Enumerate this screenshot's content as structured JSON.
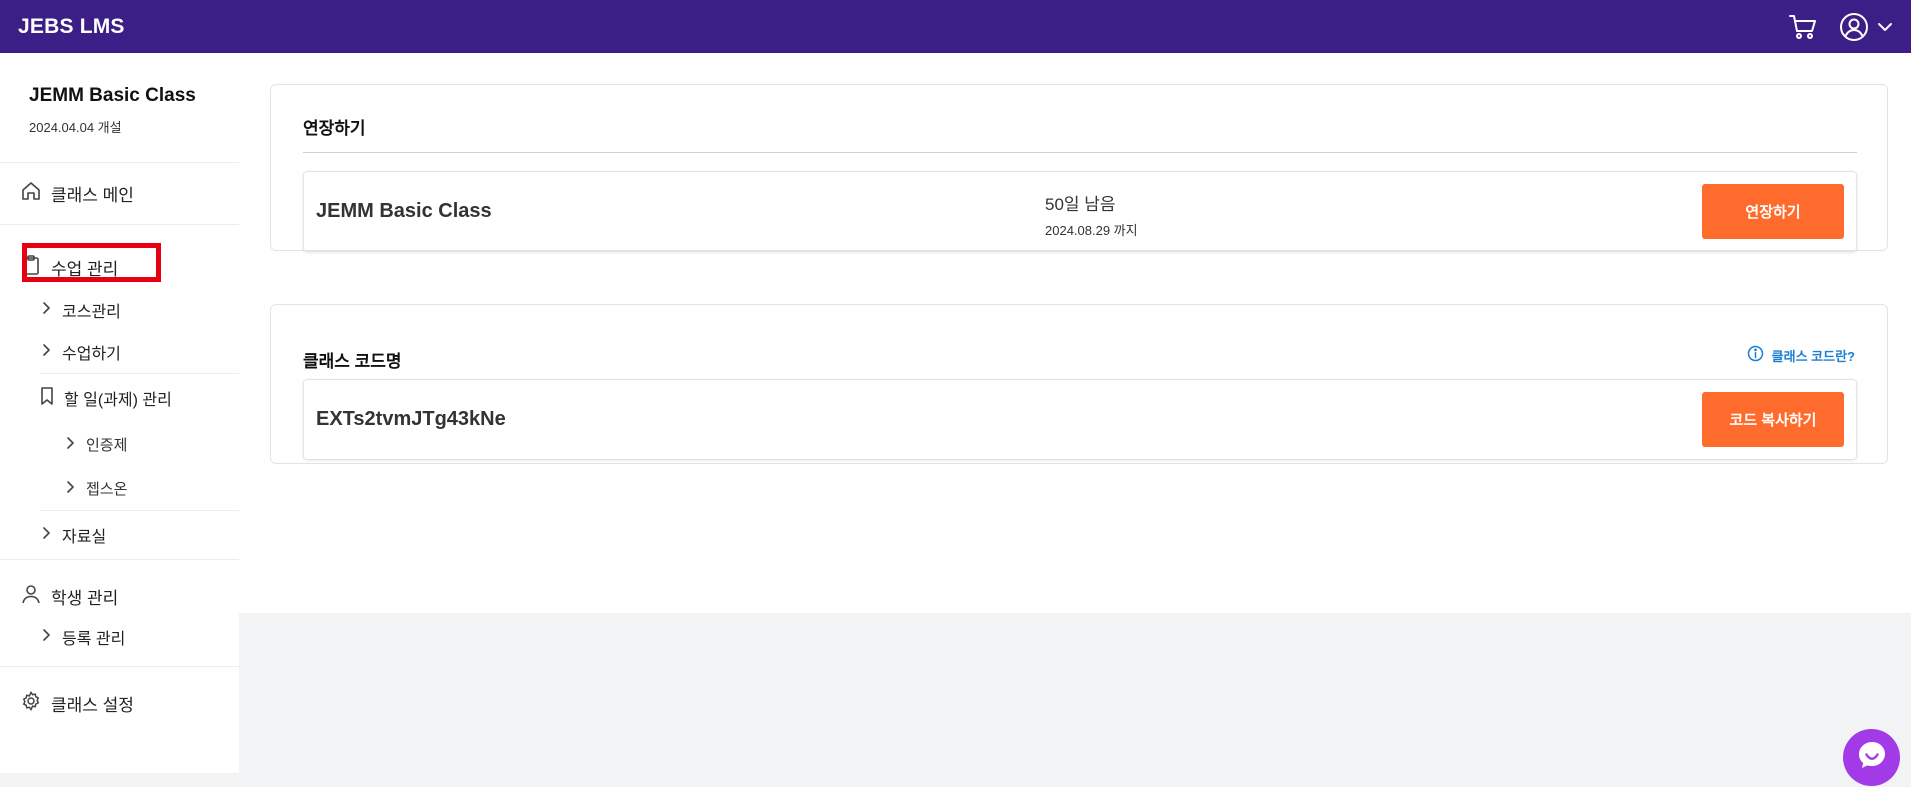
{
  "header": {
    "brand": "JEBS LMS",
    "bg_color": "#3b1f86",
    "icons": [
      "cart-icon",
      "user-circle-icon",
      "chevron-down-icon"
    ]
  },
  "sidebar": {
    "class_title": "JEMM Basic Class",
    "class_date": "2024.04.04 개설",
    "home_label": "클래스 메인",
    "lesson_mgmt_label": "수업 관리",
    "course_mgmt_label": "코스관리",
    "do_lesson_label": "수업하기",
    "todo_label": "할 일(과제) 관리",
    "cert_label": "인증제",
    "jebson_label": "젭스온",
    "library_label": "자료실",
    "student_mgmt_label": "학생 관리",
    "enroll_label": "등록 관리",
    "settings_label": "클래스 설정"
  },
  "extend_card": {
    "heading": "연장하기",
    "class_name": "JEMM Basic Class",
    "days_left": "50일 남음",
    "until": "2024.08.29 까지",
    "button": "연장하기"
  },
  "code_card": {
    "heading": "클래스 코드명",
    "help": "클래스 코드란?",
    "code": "EXTs2tvmJTg43kNe",
    "button": "코드 복사하기"
  },
  "colors": {
    "accent": "#ff6b2c",
    "link": "#1a7fd4",
    "chat": "#a23ae8",
    "highlight": "#e60012"
  }
}
